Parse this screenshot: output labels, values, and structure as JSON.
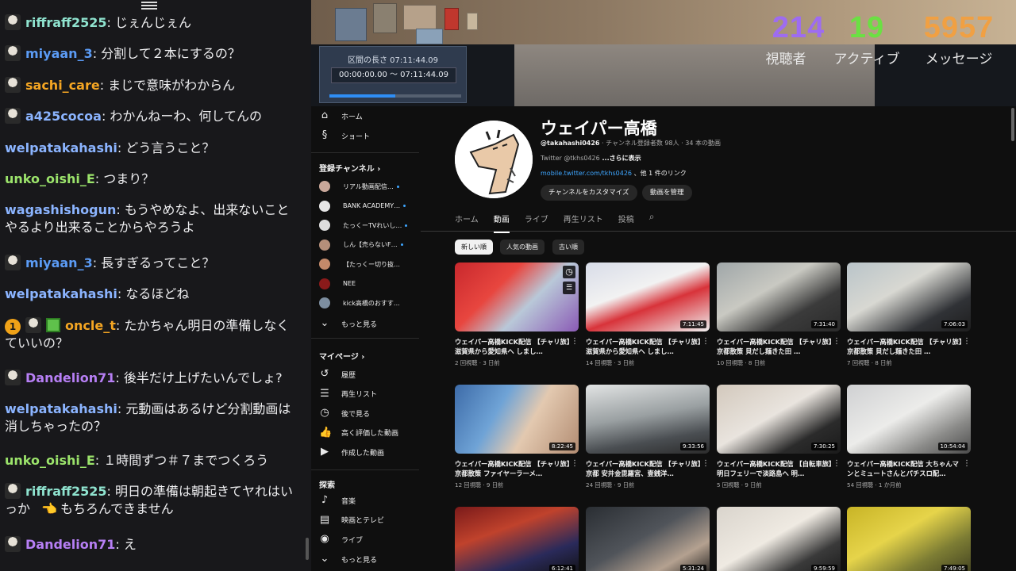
{
  "chat": {
    "messages": [
      {
        "user": "riffraff2525",
        "color": "#8fe3cf",
        "text": ": じぇんじぇん",
        "avatar": true
      },
      {
        "user": "miyaan_3",
        "color": "#5b9bf5",
        "text": ": 分割して２本にするの？",
        "avatar": true
      },
      {
        "user": "sachi_care",
        "color": "#f5a623",
        "text": ": まじで意味がわからん",
        "avatar": true
      },
      {
        "user": "a425cocoa",
        "color": "#8bb4ff",
        "text": ": わかんねーわ、何してんの",
        "avatar": true
      },
      {
        "user": "welpatakahashi",
        "color": "#8bb4ff",
        "text": ": どう言うこと？",
        "avatar": false
      },
      {
        "user": "unko_oishi_E",
        "color": "#9be36b",
        "text": ": つまり？",
        "avatar": false
      },
      {
        "user": "wagashishogun",
        "color": "#8bb4ff",
        "text": ": もうやめなよ、出来ないことやるより出来ることからやろうよ",
        "avatar": false
      },
      {
        "user": "miyaan_3",
        "color": "#5b9bf5",
        "text": ": 長すぎるってこと？",
        "avatar": true
      },
      {
        "user": "welpatakahashi",
        "color": "#8bb4ff",
        "text": ": なるほどね",
        "avatar": false
      },
      {
        "user": "oncle_t",
        "color": "#f5a623",
        "text": ": たかちゃん明日の準備しなくていいの？",
        "avatar": true,
        "badge": "1",
        "gift": true
      },
      {
        "user": "Dandelion71",
        "color": "#b77ff5",
        "text": ": 後半だけ上げたいんでしょ?",
        "avatar": true
      },
      {
        "user": "welpatakahashi",
        "color": "#8bb4ff",
        "text": ": 元動画はあるけど分割動画は消しちゃったの？",
        "avatar": false
      },
      {
        "user": "unko_oishi_E",
        "color": "#9be36b",
        "text": ": １時間ずつ＃７までつくろう",
        "avatar": false
      },
      {
        "user": "riffraff2525",
        "color": "#8fe3cf",
        "text": ": 明日の準備は朝起きてヤれはいっか",
        "avatar": true,
        "emote": "👈",
        "tail": "もちろんできません"
      },
      {
        "user": "Dandelion71",
        "color": "#b77ff5",
        "text": ": え",
        "avatar": true
      }
    ]
  },
  "overlay": {
    "editor_label": "区間の長さ 07:11:44.09",
    "editor_range": "00:00:00.00 ～ 07:11:44.09",
    "editor_progress": 0.5,
    "stats": [
      {
        "value": "214",
        "label": "視聴者",
        "color": "#9e6cf0"
      },
      {
        "value": "19",
        "label": "アクティブ",
        "color": "#6be043"
      },
      {
        "value": "5957",
        "label": "メッセージ",
        "color": "#f0a043"
      }
    ]
  },
  "youtube": {
    "nav_top": [
      {
        "icon": "home-icon",
        "glyph": "⌂",
        "label": "ホーム"
      },
      {
        "icon": "shorts-icon",
        "glyph": "§",
        "label": "ショート"
      }
    ],
    "subscriptions_heading": "登録チャンネル",
    "subscriptions": [
      {
        "label": "リアル動画配信…",
        "color": "#c9a89a",
        "live": true
      },
      {
        "label": "BANK ACADEMY…",
        "color": "#e6e6e6",
        "live": true
      },
      {
        "label": "たっくーTVれいし…",
        "color": "#dddddd",
        "live": true
      },
      {
        "label": "しん【売らないF…",
        "color": "#b58f7a",
        "live": true
      },
      {
        "label": "【たっくー切り抜…",
        "color": "#c48a6a",
        "live": false
      },
      {
        "label": "NEE",
        "color": "#8a1a1a",
        "live": false
      },
      {
        "label": "kick高橋のおすす…",
        "color": "#7d8ea0",
        "live": false
      }
    ],
    "more_label_1": "もっと見る",
    "mypage_heading": "マイページ",
    "mypage": [
      {
        "icon": "history-icon",
        "glyph": "↺",
        "label": "履歴"
      },
      {
        "icon": "playlist-icon",
        "glyph": "☰",
        "label": "再生リスト"
      },
      {
        "icon": "watch-later-icon",
        "glyph": "◷",
        "label": "後で見る"
      },
      {
        "icon": "liked-icon",
        "glyph": "👍",
        "label": "高く評価した動画"
      },
      {
        "icon": "your-videos-icon",
        "glyph": "▶",
        "label": "作成した動画"
      }
    ],
    "explore_heading": "探索",
    "explore": [
      {
        "icon": "music-icon",
        "glyph": "♪",
        "label": "音楽"
      },
      {
        "icon": "movies-icon",
        "glyph": "▤",
        "label": "映画とテレビ"
      },
      {
        "icon": "live-icon",
        "glyph": "◉",
        "label": "ライブ"
      }
    ],
    "more_label_2": "もっと見る",
    "channel": {
      "name": "ウェイパー高橋",
      "handle": "@takahashi0426",
      "meta": " · チャンネル登録者数 98人 · 34 本の動画",
      "desc": "Twitter @tkhs0426",
      "desc_more": " ...さらに表示",
      "link": "mobile.twitter.com/tkhs0426",
      "link_more": " 、他 1 件のリンク",
      "btn_customize": "チャンネルをカスタマイズ",
      "btn_manage": "動画を管理"
    },
    "tabs": [
      "ホーム",
      "動画",
      "ライブ",
      "再生リスト",
      "投稿"
    ],
    "active_tab": 1,
    "chips": [
      "新しい順",
      "人気の動画",
      "古い順"
    ],
    "videos": [
      {
        "title": "ウェイパー高橋KICK配信 【チャリ旅】滋賀県から愛知県へ しまし…",
        "meta": "2 回視聴 · 3 日前",
        "duration": "",
        "bg": "linear-gradient(135deg,#c8282d 0%,#e8463f 35%,#b9c8d8 60%,#8a5ab5 100%)",
        "clock": true
      },
      {
        "title": "ウェイパー高橋KICK配信 【チャリ旅】滋賀県から愛知県へ しまし…",
        "meta": "14 回視聴 · 3 日前",
        "duration": "7:11:45",
        "bg": "linear-gradient(160deg,#d8dce8 0%,#f2f2f2 40%,#d8333a 60%,#efefef 100%)"
      },
      {
        "title": "ウェイパー高橋KICK配信 【チャリ旅】京都散策 貝だし麺きた田 …",
        "meta": "10 回視聴 · 8 日前",
        "duration": "7:31:40",
        "bg": "linear-gradient(150deg,#9fa6a8 0%,#c9c9c2 40%,#3b3b3b 70%,#2a2a2a 100%)"
      },
      {
        "title": "ウェイパー高橋KICK配信 【チャリ旅】京都散策 貝だし麺きた田 …",
        "meta": "7 回視聴 · 8 日前",
        "duration": "7:06:03",
        "bg": "linear-gradient(150deg,#b9c4c9 0%,#d8d8d2 40%,#303236 75%,#1e1e1e 100%)"
      },
      {
        "title": "ウェイパー高橋KICK配信 【チャリ旅】京都散策 ファイヤーラーメ…",
        "meta": "12 回視聴 · 9 日前",
        "duration": "8:22:45",
        "bg": "linear-gradient(120deg,#3d6ba8 0%,#6fa3d6 35%,#e3c9b0 60%,#b28c72 100%)"
      },
      {
        "title": "ウェイパー高橋KICK配信 【チャリ旅】京都 安井金毘羅宮、壹銭洋…",
        "meta": "24 回視聴 · 9 日前",
        "duration": "9:33:56",
        "bg": "linear-gradient(170deg,#e2e4e4 0%,#9aa0a2 45%,#4a4e52 75%,#2c2c2c 100%)"
      },
      {
        "title": "ウェイパー高橋KICK配信 【自転車旅】明日フェリーで淡路島へ 明…",
        "meta": "5 回視聴 · 9 日前",
        "duration": "7:30:25",
        "bg": "linear-gradient(150deg,#d2c8bc 0%,#e9e4de 45%,#2b2b2b 75%,#1a1a1a 100%)"
      },
      {
        "title": "ウェイパー高橋KICK配信 大ちゃんマンとミュートさんとパチスロ配…",
        "meta": "54 回視聴 · 1 か月前",
        "duration": "10:54:04",
        "bg": "linear-gradient(150deg,#cfd0d2 0%,#ececea 45%,#8a8a88 75%,#4b4b4b 100%)"
      },
      {
        "title": "",
        "meta": "",
        "duration": "6:12:41",
        "bg": "linear-gradient(160deg,#7a1a1a 0%,#c0422c 35%,#2a2a5a 70%,#111 100%)"
      },
      {
        "title": "",
        "meta": "",
        "duration": "5:31:24",
        "bg": "linear-gradient(150deg,#2a2e33 0%,#50545a 45%,#b4a190 75%,#22201e 100%)"
      },
      {
        "title": "",
        "meta": "",
        "duration": "9:59:59",
        "bg": "linear-gradient(150deg,#d9d4cc 0%,#efeae2 45%,#3a3a3a 75%,#1b1b1b 100%)"
      },
      {
        "title": "",
        "meta": "",
        "duration": "7:49:05",
        "bg": "linear-gradient(150deg,#c8b426 0%,#e6d44a 40%,#7d7d34 70%,#404020 100%)"
      }
    ]
  }
}
